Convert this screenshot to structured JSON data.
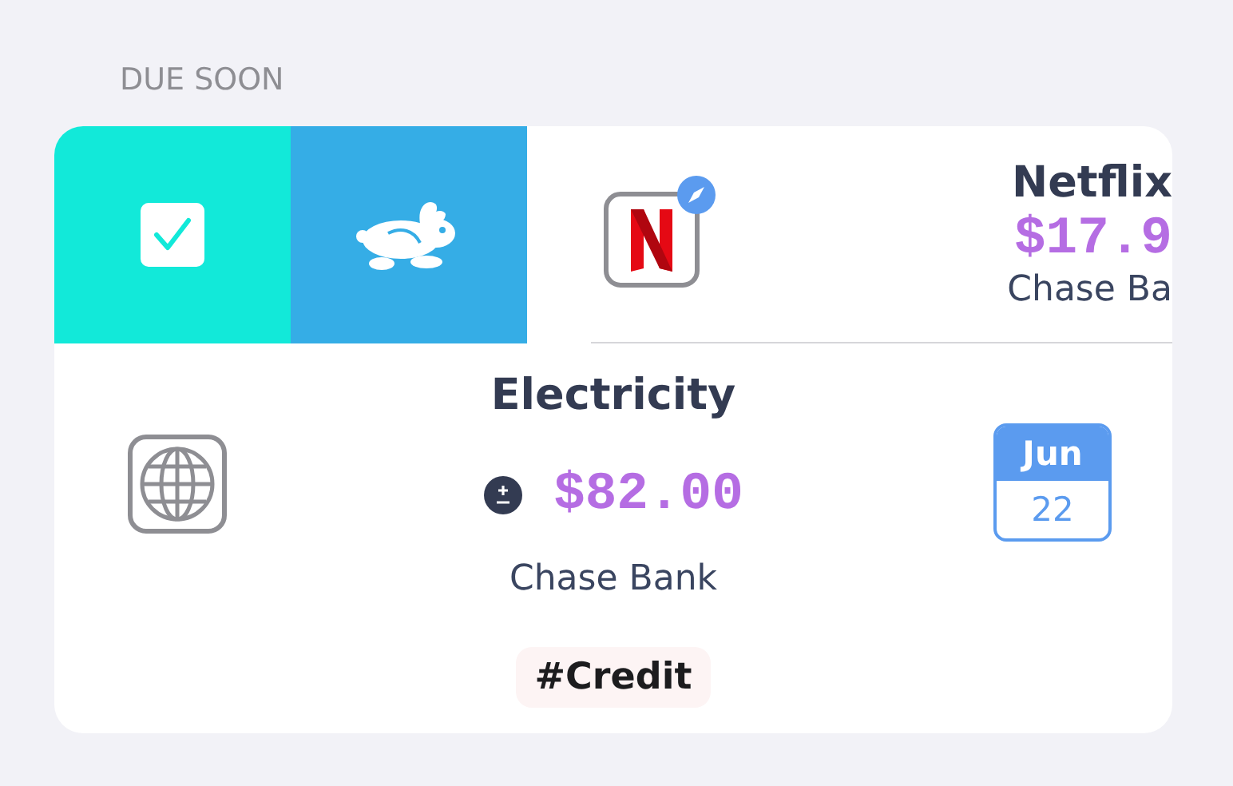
{
  "section_title": "DUE SOON",
  "swipe_actions": [
    {
      "kind": "complete",
      "color": "#12e9d9"
    },
    {
      "kind": "rabbit",
      "color": "#35ade6"
    }
  ],
  "bills": [
    {
      "name": "Netflix",
      "amount": "$17.9",
      "account": "Chase Ba",
      "kind": "netflix",
      "link_badge": true,
      "swiped": true
    },
    {
      "name": "Electricity",
      "amount": "$82.00",
      "account": "Chase Bank",
      "kind": "globe",
      "swiped": false,
      "variable": true,
      "tag": "#Credit",
      "due": {
        "month": "Jun",
        "day": "22"
      }
    }
  ]
}
